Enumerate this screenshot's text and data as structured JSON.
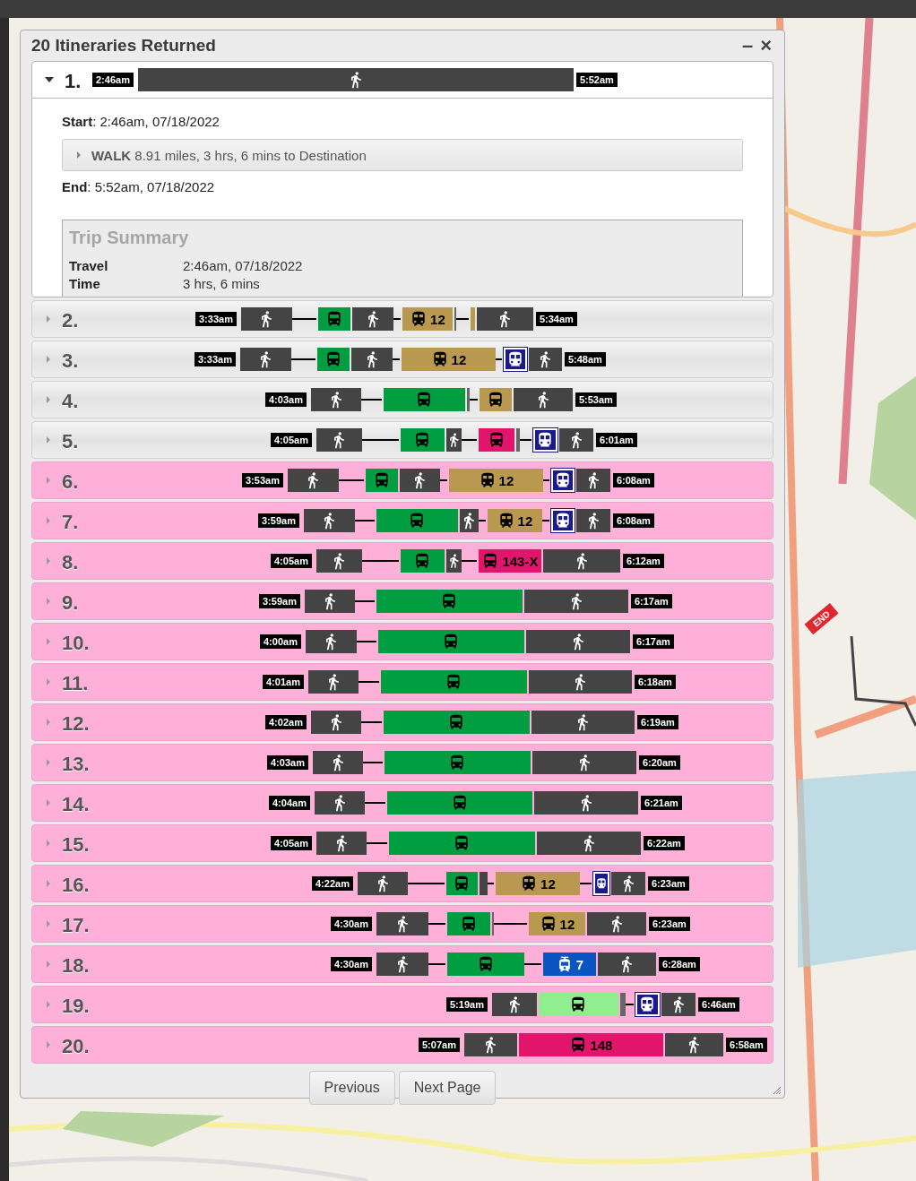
{
  "panel": {
    "title": "20 Itineraries Returned",
    "minimize": "–",
    "close": "×"
  },
  "itineraries": [
    {
      "number": "1.",
      "expanded": true,
      "highlighted": false,
      "start": "2:46am",
      "end": "5:52am",
      "segments": [
        {
          "kind": "walk"
        }
      ],
      "details": {
        "start": "**Start**: 2:46am, 07/18/2022",
        "leg": {
          "text": "**WALK** 8.91 miles, 3 hrs, 6 mins to Destination",
          "expanded": false
        },
        "end": "**End**: 5:52am, 07/18/2022",
        "summary": {
          "title": "Trip Summary",
          "rows": [
            {
              "label": "Travel",
              "value": "2:46am, 07/18/2022"
            },
            {
              "label": "Time",
              "value": "3 hrs, 6 mins"
            }
          ]
        }
      }
    },
    {
      "number": "2.",
      "expanded": false,
      "highlighted": false,
      "start": "3:33am",
      "end": "5:34am",
      "segments": [
        {
          "kind": "walk"
        },
        {
          "kind": "line"
        },
        {
          "kind": "bus",
          "color": "#009e41"
        },
        {
          "kind": "walk"
        },
        {
          "kind": "line"
        },
        {
          "kind": "rail",
          "color": "#b8994f",
          "label": "12"
        },
        {
          "kind": "tick"
        },
        {
          "kind": "line"
        },
        {
          "kind": "bus",
          "color": "#b8994f"
        },
        {
          "kind": "walk"
        }
      ]
    },
    {
      "number": "3.",
      "expanded": false,
      "highlighted": false,
      "start": "3:33am",
      "end": "5:48am",
      "segments": [
        {
          "kind": "walk"
        },
        {
          "kind": "line"
        },
        {
          "kind": "bus",
          "color": "#009e41"
        },
        {
          "kind": "walk"
        },
        {
          "kind": "line"
        },
        {
          "kind": "rail",
          "color": "#b8994f",
          "label": "12"
        },
        {
          "kind": "line"
        },
        {
          "kind": "subway"
        },
        {
          "kind": "walk"
        }
      ]
    },
    {
      "number": "4.",
      "expanded": false,
      "highlighted": false,
      "start": "4:03am",
      "end": "5:53am",
      "segments": [
        {
          "kind": "walk"
        },
        {
          "kind": "line"
        },
        {
          "kind": "bus",
          "color": "#009e41"
        },
        {
          "kind": "tick"
        },
        {
          "kind": "line"
        },
        {
          "kind": "bus",
          "color": "#b8994f"
        },
        {
          "kind": "walk"
        }
      ]
    },
    {
      "number": "5.",
      "expanded": false,
      "highlighted": false,
      "start": "4:05am",
      "end": "6:01am",
      "segments": [
        {
          "kind": "walk"
        },
        {
          "kind": "line"
        },
        {
          "kind": "bus",
          "color": "#009e41"
        },
        {
          "kind": "walk"
        },
        {
          "kind": "line"
        },
        {
          "kind": "bus",
          "color": "#e0156b"
        },
        {
          "kind": "tick"
        },
        {
          "kind": "line"
        },
        {
          "kind": "subway"
        },
        {
          "kind": "walk"
        }
      ]
    },
    {
      "number": "6.",
      "expanded": false,
      "highlighted": true,
      "start": "3:53am",
      "end": "6:08am",
      "segments": [
        {
          "kind": "walk"
        },
        {
          "kind": "line"
        },
        {
          "kind": "bus",
          "color": "#009e41"
        },
        {
          "kind": "walk"
        },
        {
          "kind": "line"
        },
        {
          "kind": "rail",
          "color": "#b8994f",
          "label": "12"
        },
        {
          "kind": "line"
        },
        {
          "kind": "subway"
        },
        {
          "kind": "walk"
        }
      ]
    },
    {
      "number": "7.",
      "expanded": false,
      "highlighted": true,
      "start": "3:59am",
      "end": "6:08am",
      "segments": [
        {
          "kind": "walk"
        },
        {
          "kind": "line"
        },
        {
          "kind": "bus",
          "color": "#009e41"
        },
        {
          "kind": "walk"
        },
        {
          "kind": "line"
        },
        {
          "kind": "rail",
          "color": "#b8994f",
          "label": "12"
        },
        {
          "kind": "line"
        },
        {
          "kind": "subway"
        },
        {
          "kind": "walk"
        }
      ]
    },
    {
      "number": "8.",
      "expanded": false,
      "highlighted": true,
      "start": "4:05am",
      "end": "6:12am",
      "segments": [
        {
          "kind": "walk"
        },
        {
          "kind": "line"
        },
        {
          "kind": "bus",
          "color": "#009e41"
        },
        {
          "kind": "walk"
        },
        {
          "kind": "line"
        },
        {
          "kind": "bus",
          "color": "#e0156b",
          "label": "143-X"
        },
        {
          "kind": "walk"
        }
      ]
    },
    {
      "number": "9.",
      "expanded": false,
      "highlighted": true,
      "start": "3:59am",
      "end": "6:17am",
      "segments": [
        {
          "kind": "walk"
        },
        {
          "kind": "line"
        },
        {
          "kind": "bus",
          "color": "#009e41"
        },
        {
          "kind": "walk"
        }
      ]
    },
    {
      "number": "10.",
      "expanded": false,
      "highlighted": true,
      "start": "4:00am",
      "end": "6:17am",
      "segments": [
        {
          "kind": "walk"
        },
        {
          "kind": "line"
        },
        {
          "kind": "bus",
          "color": "#009e41"
        },
        {
          "kind": "walk"
        }
      ]
    },
    {
      "number": "11.",
      "expanded": false,
      "highlighted": true,
      "start": "4:01am",
      "end": "6:18am",
      "segments": [
        {
          "kind": "walk"
        },
        {
          "kind": "line"
        },
        {
          "kind": "bus",
          "color": "#009e41"
        },
        {
          "kind": "walk"
        }
      ]
    },
    {
      "number": "12.",
      "expanded": false,
      "highlighted": true,
      "start": "4:02am",
      "end": "6:19am",
      "segments": [
        {
          "kind": "walk"
        },
        {
          "kind": "line"
        },
        {
          "kind": "bus",
          "color": "#009e41"
        },
        {
          "kind": "walk"
        }
      ]
    },
    {
      "number": "13.",
      "expanded": false,
      "highlighted": true,
      "start": "4:03am",
      "end": "6:20am",
      "segments": [
        {
          "kind": "walk"
        },
        {
          "kind": "line"
        },
        {
          "kind": "bus",
          "color": "#009e41"
        },
        {
          "kind": "walk"
        }
      ]
    },
    {
      "number": "14.",
      "expanded": false,
      "highlighted": true,
      "start": "4:04am",
      "end": "6:21am",
      "segments": [
        {
          "kind": "walk"
        },
        {
          "kind": "line"
        },
        {
          "kind": "bus",
          "color": "#009e41"
        },
        {
          "kind": "walk"
        }
      ]
    },
    {
      "number": "15.",
      "expanded": false,
      "highlighted": true,
      "start": "4:05am",
      "end": "6:22am",
      "segments": [
        {
          "kind": "walk"
        },
        {
          "kind": "line"
        },
        {
          "kind": "bus",
          "color": "#009e41"
        },
        {
          "kind": "walk"
        }
      ]
    },
    {
      "number": "16.",
      "expanded": false,
      "highlighted": true,
      "start": "4:22am",
      "end": "6:23am",
      "segments": [
        {
          "kind": "walk"
        },
        {
          "kind": "line"
        },
        {
          "kind": "bus",
          "color": "#009e41"
        },
        {
          "kind": "walk"
        },
        {
          "kind": "line"
        },
        {
          "kind": "rail",
          "color": "#b8994f",
          "label": "12"
        },
        {
          "kind": "line"
        },
        {
          "kind": "subway"
        },
        {
          "kind": "walk"
        }
      ]
    },
    {
      "number": "17.",
      "expanded": false,
      "highlighted": true,
      "start": "4:30am",
      "end": "6:23am",
      "segments": [
        {
          "kind": "walk"
        },
        {
          "kind": "line"
        },
        {
          "kind": "bus",
          "color": "#009e41"
        },
        {
          "kind": "tick"
        },
        {
          "kind": "line"
        },
        {
          "kind": "bus",
          "color": "#b8994f",
          "label": "12"
        },
        {
          "kind": "walk"
        }
      ]
    },
    {
      "number": "18.",
      "expanded": false,
      "highlighted": true,
      "start": "4:30am",
      "end": "6:28am",
      "segments": [
        {
          "kind": "walk"
        },
        {
          "kind": "line"
        },
        {
          "kind": "bus",
          "color": "#009e41"
        },
        {
          "kind": "line"
        },
        {
          "kind": "trolleybus",
          "color": "#0a55c2",
          "label": "7"
        },
        {
          "kind": "walk"
        }
      ]
    },
    {
      "number": "19.",
      "expanded": false,
      "highlighted": true,
      "start": "5:19am",
      "end": "6:46am",
      "segments": [
        {
          "kind": "walk"
        },
        {
          "kind": "bus",
          "color": "#90ee90"
        },
        {
          "kind": "tick"
        },
        {
          "kind": "line"
        },
        {
          "kind": "subway"
        },
        {
          "kind": "walk"
        }
      ]
    },
    {
      "number": "20.",
      "expanded": false,
      "highlighted": true,
      "start": "5:07am",
      "end": "6:58am",
      "segments": [
        {
          "kind": "walk"
        },
        {
          "kind": "bus",
          "color": "#e0156b",
          "label": "148"
        },
        {
          "kind": "walk"
        }
      ]
    }
  ],
  "pager": {
    "previous": "Previous",
    "next": "Next Page"
  },
  "map": {
    "end_marker": "END"
  }
}
